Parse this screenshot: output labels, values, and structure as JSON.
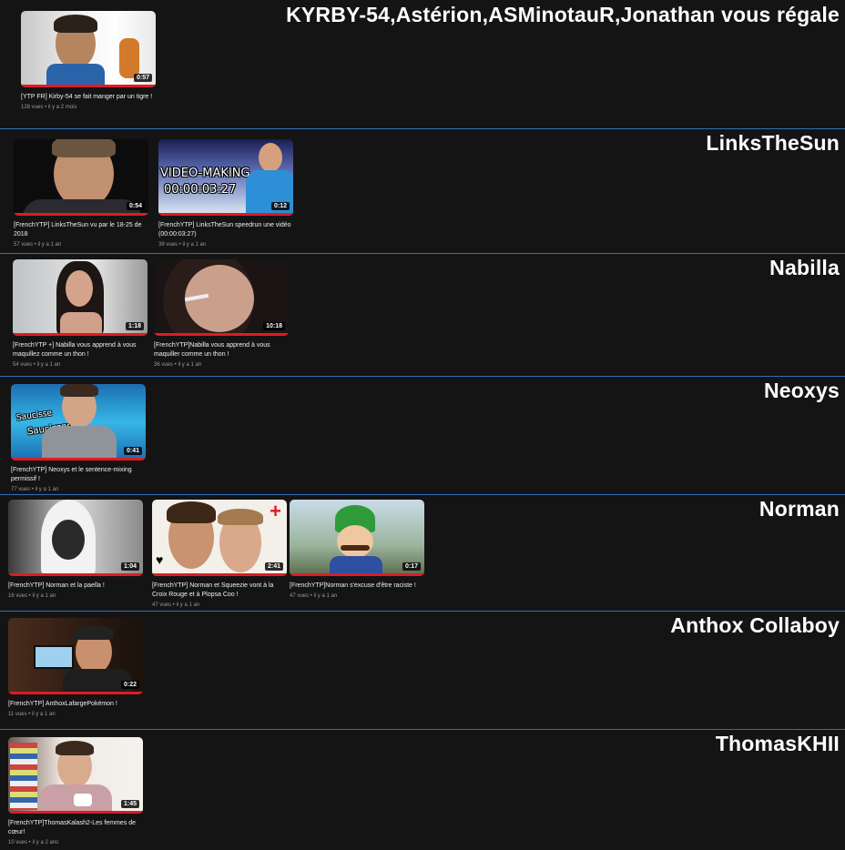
{
  "sections": [
    {
      "title": "KYRBY-54,Astérion,ASMinotauR,Jonathan vous régale",
      "videos": [
        {
          "title": "[YTP FR] Kirby-54 se fait manger par un tigre !",
          "meta": "128 vues • il y a 2 mois",
          "duration": "0:57",
          "progress": 1.0,
          "thumb_colors": [
            "#d9d9d9",
            "#8a6a4a"
          ]
        }
      ]
    },
    {
      "title": "LinksTheSun",
      "videos": [
        {
          "title": "[FrenchYTP] LinksTheSun vu par le 18-25 de 2018",
          "meta": "57 vues • il y a 1 an",
          "duration": "0:54",
          "progress": 1.0,
          "thumb_colors": [
            "#1a1a1a",
            "#b08a6a"
          ]
        },
        {
          "title": "[FrenchYTP] LinksTheSun speedrun une vidéo (00:00:03:27)",
          "meta": "39 vues • il y a 1 an",
          "duration": "0:12",
          "progress": 1.0,
          "thumb_colors": [
            "#2a2f6a",
            "#9ec7ea"
          ],
          "overlay_lines": [
            "VIDEO-MAKING",
            "00:00:03:27"
          ]
        }
      ]
    },
    {
      "title": "Nabilla",
      "videos": [
        {
          "title": "[FrenchYTP +] Nabilla vous apprend à vous maquillez comme un thon !",
          "meta": "54 vues • il y a 1 an",
          "duration": "1:18",
          "progress": 1.0,
          "thumb_colors": [
            "#cfcfcf",
            "#3a2a24"
          ]
        },
        {
          "title": "[FrenchYTP]Nabilla vous apprend à vous maquiller comme un thon !",
          "meta": "36 vues • il y a 1 an",
          "duration": "10:18",
          "progress": 1.0,
          "thumb_colors": [
            "#2a2020",
            "#c79a86"
          ]
        }
      ]
    },
    {
      "title": "Neoxys",
      "videos": [
        {
          "title": "[FrenchYTP] Neoxys et le sentence-mixing permissif !",
          "meta": "77 vues • il y a 1 an",
          "duration": "0:41",
          "progress": 1.0,
          "thumb_colors": [
            "#2fa6d9",
            "#c89a80"
          ],
          "overlay_lines": [
            "Saucisse",
            "Saucisson"
          ]
        }
      ]
    },
    {
      "title": "Norman",
      "videos": [
        {
          "title": "[FrenchYTP] Norman et la paella !",
          "meta": "16 vues • il y a 1 an",
          "duration": "1:04",
          "progress": 1.0,
          "thumb_colors": [
            "#bdbdbd",
            "#1e1e1e"
          ]
        },
        {
          "title": "[FrenchYTP] Norman et Squeezie vont à la Croix Rouge et à Plopsa Coo !",
          "meta": "47 vues • il y a 1 an",
          "duration": "2:41",
          "progress": 1.0,
          "thumb_colors": [
            "#f0ece6",
            "#c99072"
          ]
        },
        {
          "title": "[FrenchYTP]Norman s'excuse d'être raciste !",
          "meta": "47 vues • il y a 1 an",
          "duration": "0:17",
          "progress": 1.0,
          "thumb_colors": [
            "#8fb2a0",
            "#2f8f3a"
          ]
        }
      ]
    },
    {
      "title": "Anthox Collaboy",
      "videos": [
        {
          "title": "[FrenchYTP] AnthoxLafargePokémon !",
          "meta": "11 vues • il y a 1 an",
          "duration": "0:22",
          "progress": 1.0,
          "thumb_colors": [
            "#3a2418",
            "#c89070"
          ]
        }
      ]
    },
    {
      "title": "ThomasKHII",
      "videos": [
        {
          "title": "[FrenchYTP]ThomasKalash2-Les femmes de cœur!",
          "meta": "10 vues • il y a 2 ans",
          "duration": "1:45",
          "progress": 1.0,
          "thumb_colors": [
            "#e8e4de",
            "#c9a08a"
          ]
        }
      ]
    }
  ],
  "colors": {
    "background": "#141414",
    "divider": "#2f6fb8",
    "progress": "#e01b24"
  }
}
